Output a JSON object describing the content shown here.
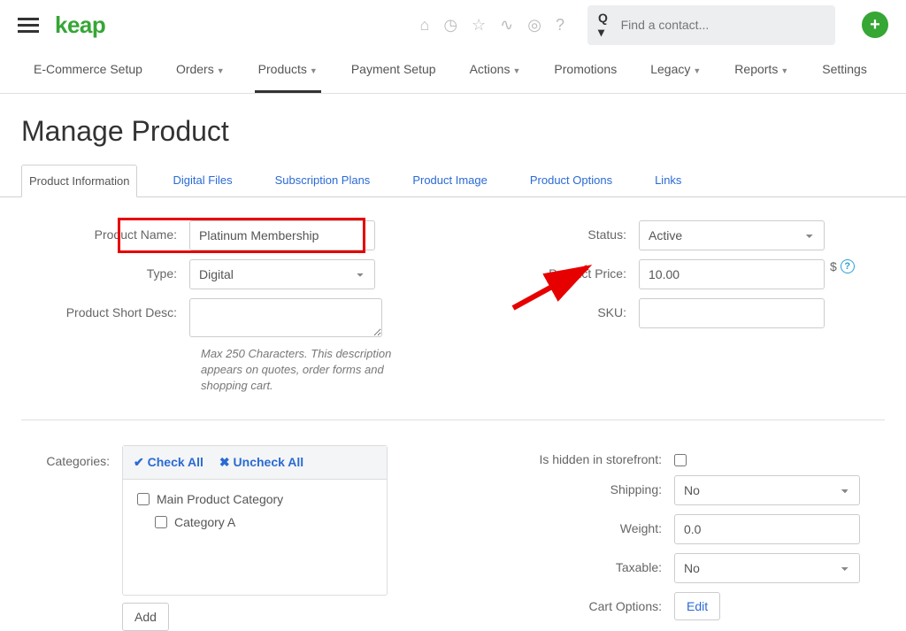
{
  "header": {
    "logo_text": "keap",
    "search_placeholder": "Find a contact..."
  },
  "main_nav": {
    "ecommerce": "E-Commerce Setup",
    "orders": "Orders",
    "products": "Products",
    "payment": "Payment Setup",
    "actions": "Actions",
    "promotions": "Promotions",
    "legacy": "Legacy",
    "reports": "Reports",
    "settings": "Settings"
  },
  "page": {
    "title": "Manage Product"
  },
  "tabs": {
    "info": "Product Information",
    "digital": "Digital Files",
    "subscription": "Subscription Plans",
    "image": "Product  Image",
    "options": "Product  Options",
    "links": "Links"
  },
  "form": {
    "labels": {
      "name": "Product Name:",
      "type": "Type:",
      "short_desc": "Product Short Desc:",
      "status": "Status:",
      "price": "Product Price:",
      "sku": "SKU:",
      "categories": "Categories:",
      "hidden": "Is hidden in storefront:",
      "shipping": "Shipping:",
      "weight": "Weight:",
      "taxable": "Taxable:",
      "cart": "Cart Options:"
    },
    "values": {
      "name": "Platinum Membership",
      "type": "Digital",
      "short_desc": "",
      "status": "Active",
      "price": "10.00",
      "sku": "",
      "shipping": "No",
      "weight": "0.0",
      "taxable": "No"
    },
    "help_desc": "Max 250 Characters. This description appears on quotes, order forms and shopping cart.",
    "currency": "$"
  },
  "categories": {
    "check_all": "Check All",
    "uncheck_all": "Uncheck All",
    "main": "Main Product Category",
    "sub": "Category A",
    "add_btn": "Add"
  },
  "buttons": {
    "edit": "Edit"
  }
}
